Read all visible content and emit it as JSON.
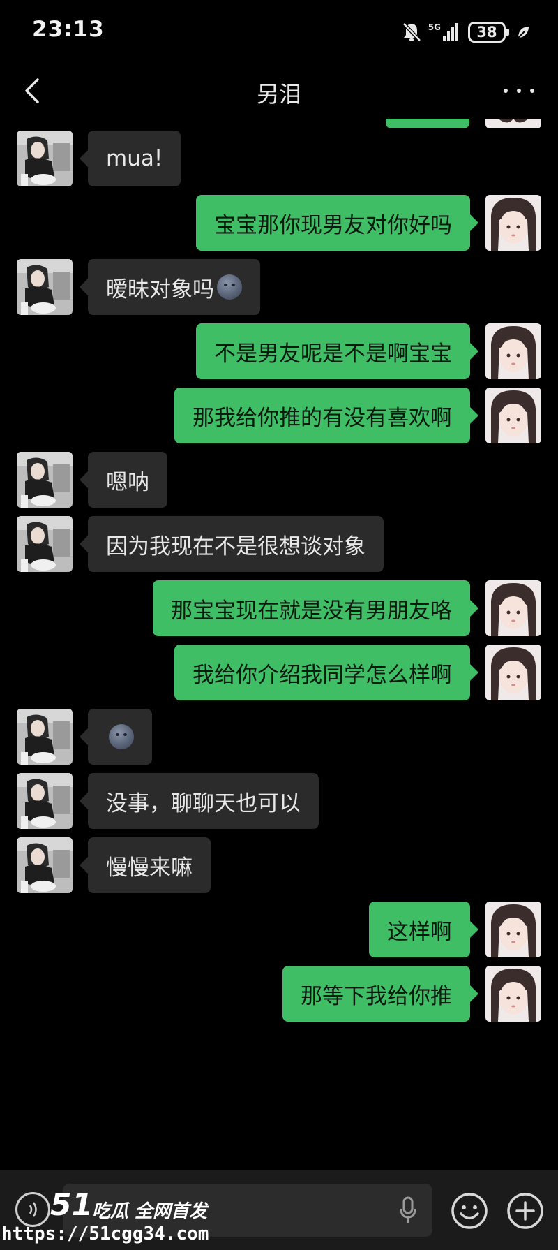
{
  "status_bar": {
    "time": "23:13",
    "network": "5G",
    "battery": "38"
  },
  "header": {
    "title": "另泪"
  },
  "messages": [
    {
      "side": "left",
      "text": "mua!"
    },
    {
      "side": "right",
      "text": "宝宝那你现男友对你好吗"
    },
    {
      "side": "left",
      "text": "暧昧对象吗",
      "emoji": "moon-face"
    },
    {
      "side": "right",
      "text": "不是男友呢是不是啊宝宝"
    },
    {
      "side": "right",
      "text": "那我给你推的有没有喜欢啊"
    },
    {
      "side": "left",
      "text": "嗯呐"
    },
    {
      "side": "left",
      "text": "因为我现在不是很想谈对象"
    },
    {
      "side": "right",
      "text": "那宝宝现在就是没有男朋友咯"
    },
    {
      "side": "right",
      "text": "我给你介绍我同学怎么样啊"
    },
    {
      "side": "left",
      "text": "",
      "emoji": "moon-face"
    },
    {
      "side": "left",
      "text": "没事，聊聊天也可以"
    },
    {
      "side": "left",
      "text": "慢慢来嘛"
    },
    {
      "side": "right",
      "text": "这样啊"
    },
    {
      "side": "right",
      "text": "那等下我给你推"
    }
  ],
  "watermark": {
    "number": "51",
    "text": "吃瓜 全网首发",
    "url": "https://51cgg34.com"
  },
  "colors": {
    "background": "#000000",
    "bubble_self": "#3fbe66",
    "bubble_other": "#2b2b2b",
    "input_bar": "#1b1b1b"
  }
}
